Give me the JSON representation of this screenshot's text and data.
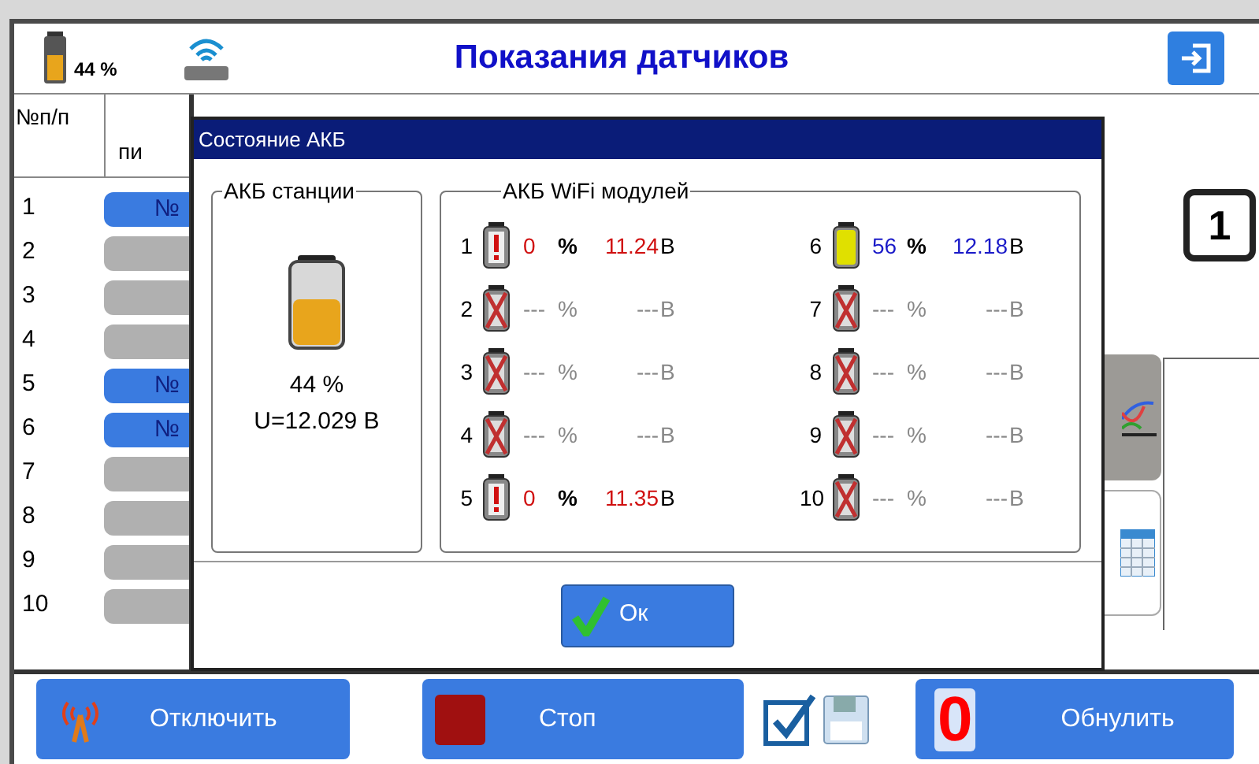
{
  "header": {
    "battery_percent": "44 %",
    "title": "Показания датчиков"
  },
  "table": {
    "columns": [
      "№п/п",
      "пи"
    ],
    "rows": [
      {
        "number": "1",
        "label": "№",
        "active": true
      },
      {
        "number": "2",
        "label": "",
        "active": false
      },
      {
        "number": "3",
        "label": "",
        "active": false
      },
      {
        "number": "4",
        "label": "",
        "active": false
      },
      {
        "number": "5",
        "label": "№",
        "active": true
      },
      {
        "number": "6",
        "label": "№",
        "active": true
      },
      {
        "number": "7",
        "label": "",
        "active": false
      },
      {
        "number": "8",
        "label": "",
        "active": false
      },
      {
        "number": "9",
        "label": "",
        "active": false
      },
      {
        "number": "10",
        "label": "",
        "active": false
      }
    ]
  },
  "side": {
    "badge": "1"
  },
  "dialog": {
    "title": "Состояние АКБ",
    "station": {
      "legend": "АКБ станции",
      "percent": "44 %",
      "voltage": "U=12.029 В"
    },
    "modules": {
      "legend": "АКБ WiFi модулей",
      "items": [
        {
          "number": "1",
          "kind": "alert",
          "percent": "0",
          "unit_percent": "%",
          "voltage": "11.24",
          "unit_voltage": "В"
        },
        {
          "number": "2",
          "kind": "none",
          "percent": "---",
          "unit_percent": "%",
          "voltage": "---",
          "unit_voltage": "В"
        },
        {
          "number": "3",
          "kind": "none",
          "percent": "---",
          "unit_percent": "%",
          "voltage": "---",
          "unit_voltage": "В"
        },
        {
          "number": "4",
          "kind": "none",
          "percent": "---",
          "unit_percent": "%",
          "voltage": "---",
          "unit_voltage": "В"
        },
        {
          "number": "5",
          "kind": "alert",
          "percent": "0",
          "unit_percent": "%",
          "voltage": "11.35",
          "unit_voltage": "В"
        },
        {
          "number": "6",
          "kind": "ok",
          "percent": "56",
          "unit_percent": "%",
          "voltage": "12.18",
          "unit_voltage": "В"
        },
        {
          "number": "7",
          "kind": "none",
          "percent": "---",
          "unit_percent": "%",
          "voltage": "---",
          "unit_voltage": "В"
        },
        {
          "number": "8",
          "kind": "none",
          "percent": "---",
          "unit_percent": "%",
          "voltage": "---",
          "unit_voltage": "В"
        },
        {
          "number": "9",
          "kind": "none",
          "percent": "---",
          "unit_percent": "%",
          "voltage": "---",
          "unit_voltage": "В"
        },
        {
          "number": "10",
          "kind": "none",
          "percent": "---",
          "unit_percent": "%",
          "voltage": "---",
          "unit_voltage": "В"
        }
      ]
    },
    "ok_button": "Ок"
  },
  "footer": {
    "disconnect": "Отключить",
    "stop": "Стоп",
    "save_checked": true,
    "reset_icon": "0",
    "reset": "Обнулить"
  }
}
